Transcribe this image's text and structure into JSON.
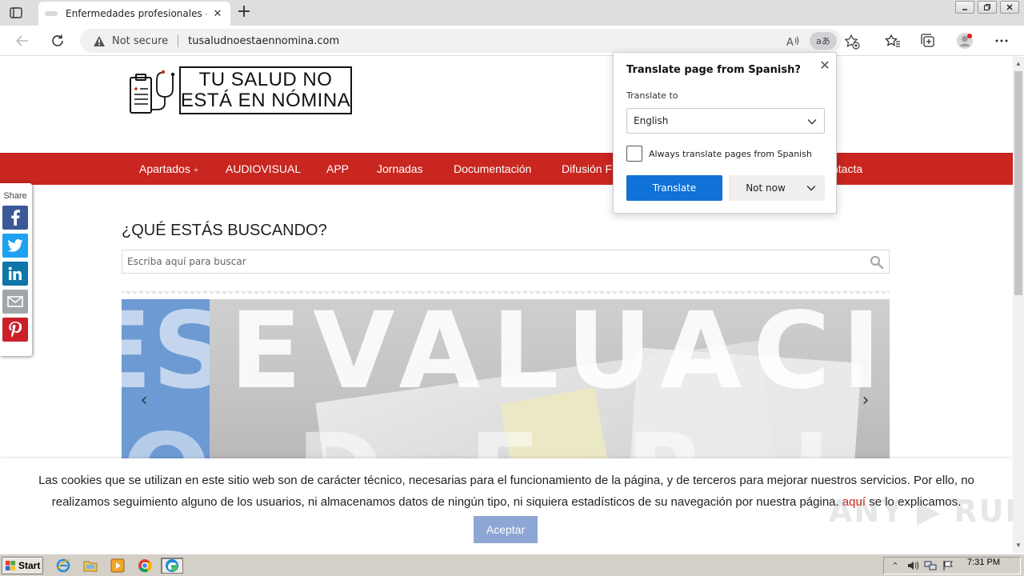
{
  "browser": {
    "tab_title": "Enfermedades profesionales - Tu salud no está en nómina",
    "tab_close": "✕",
    "new_tab": "+",
    "security_label": "Not secure",
    "url": "tusaludnoestaennomina.com",
    "translate_icon_label": "aあ"
  },
  "site": {
    "logo_line1": "TU SALUD NO",
    "logo_line2": "ESTÁ EN NÓMINA",
    "nav": [
      "Apartados",
      "AUDIOVISUAL",
      "APP",
      "Jornadas",
      "Documentación",
      "Difusión F",
      "ntacta"
    ],
    "nav_plus": "+",
    "share_label": "Share",
    "search_heading": "¿QUÉ ESTÁS BUSCANDO?",
    "search_placeholder": "Escriba aquí para buscar",
    "slider_text": "EVALUACIO",
    "slider_text_left": "ES",
    "slider_text_row2": "O D E R I E S G O",
    "slider_prev": "‹",
    "slider_next": "›"
  },
  "cookie": {
    "text_before": "Las cookies que se utilizan en este sitio web son de carácter técnico, necesarias para el funcionamiento de la página, y de terceros para mejorar nuestros servicios. Por ello, no realizamos seguimiento alguno de los usuarios, ni almacenamos datos de ningún tipo, ni siquiera estadísticos de su navegación por nuestra página. ",
    "link_text": "aquí",
    "text_after": " se lo explicamos.",
    "accept_label": "Aceptar",
    "watermark": "ANY ▶ RUN"
  },
  "translate_popup": {
    "title": "Translate page from Spanish?",
    "close": "✕",
    "translate_to_label": "Translate to",
    "selected_language": "English",
    "always_label": "Always translate pages from Spanish",
    "translate_button": "Translate",
    "not_now_button": "Not now"
  },
  "taskbar": {
    "start_label": "Start",
    "clock": "7:31 PM"
  },
  "colors": {
    "nav_red": "#c8261f",
    "translate_blue": "#1071d6",
    "accept_blue": "#8ea6d3",
    "facebook": "#3b5998",
    "twitter": "#1da1f2",
    "linkedin": "#0e76a8",
    "email": "#a0a7ab",
    "pinterest": "#cb2027"
  },
  "icons": {
    "share_buttons": [
      "facebook-icon",
      "twitter-icon",
      "linkedin-icon",
      "email-icon",
      "pinterest-icon"
    ]
  }
}
